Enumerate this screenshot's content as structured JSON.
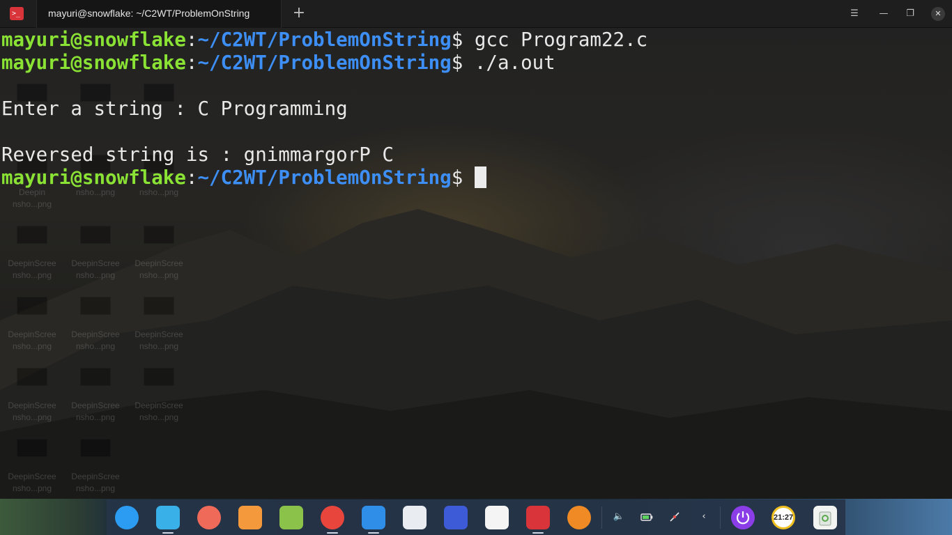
{
  "window": {
    "app_icon_glyph": ">_",
    "tab_title": "mayuri@snowflake: ~/C2WT/ProblemOnString",
    "new_tab_glyph": "+",
    "menu_glyph": "☰",
    "minimize_glyph": "—",
    "maximize_glyph": "❐",
    "close_glyph": "✕"
  },
  "terminal": {
    "lines": [
      {
        "user": "mayuri@snowflake",
        "sep": ":",
        "path": "~/C2WT/ProblemOnString",
        "prompt": "$",
        "cmd": " gcc Program22.c"
      },
      {
        "user": "mayuri@snowflake",
        "sep": ":",
        "path": "~/C2WT/ProblemOnString",
        "prompt": "$",
        "cmd": " ./a.out"
      },
      {
        "text": ""
      },
      {
        "text": "Enter a string : C Programming"
      },
      {
        "text": ""
      },
      {
        "text": "Reversed string is : gnimmargorP C"
      },
      {
        "user": "mayuri@snowflake",
        "sep": ":",
        "path": "~/C2WT/ProblemOnString",
        "prompt": "$",
        "cmd": " "
      }
    ]
  },
  "desktop": {
    "icons": [
      {
        "line1": "",
        "line2": ""
      },
      {
        "line1": "",
        "line2": ""
      },
      {
        "line1": "",
        "line2": ""
      },
      {
        "line1": "Deepin",
        "line2": "nsho...png"
      },
      {
        "line1": "",
        "line2": "nsho...png"
      },
      {
        "line1": "",
        "line2": "nsho...png"
      },
      {
        "line1": "DeepinScree",
        "line2": "nsho...png"
      },
      {
        "line1": "DeepinScree",
        "line2": "nsho...png"
      },
      {
        "line1": "DeepinScree",
        "line2": "nsho...png"
      },
      {
        "line1": "DeepinScree",
        "line2": "nsho...png"
      },
      {
        "line1": "DeepinScree",
        "line2": "nsho...png"
      },
      {
        "line1": "DeepinScree",
        "line2": "nsho...png"
      },
      {
        "line1": "DeepinScree",
        "line2": "nsho...png"
      },
      {
        "line1": "DeepinScree",
        "line2": "nsho...png"
      },
      {
        "line1": "DeepinScree",
        "line2": "nsho...png"
      },
      {
        "line1": "DeepinScree",
        "line2": "nsho...png"
      },
      {
        "line1": "DeepinScree",
        "line2": "nsho...png"
      }
    ]
  },
  "dock": {
    "apps": [
      {
        "name": "launcher-icon",
        "color": "#2b9cf2"
      },
      {
        "name": "file-manager-icon",
        "color": "#3ab0e8"
      },
      {
        "name": "screen-recorder-icon",
        "color": "#f06a5a"
      },
      {
        "name": "app-store-icon",
        "color": "#f59a3c"
      },
      {
        "name": "music-icon",
        "color": "#8bc34a"
      },
      {
        "name": "chrome-icon",
        "color": "#e8453c"
      },
      {
        "name": "video-player-icon",
        "color": "#2f8ee8"
      },
      {
        "name": "settings-icon",
        "color": "#e9edf2"
      },
      {
        "name": "wps-writer-icon",
        "color": "#3d5bd6"
      },
      {
        "name": "text-editor-icon",
        "color": "#f4f4f4"
      },
      {
        "name": "terminal-icon",
        "color": "#d8343a"
      },
      {
        "name": "vlc-icon",
        "color": "#f08a24"
      }
    ],
    "tray": {
      "volume_glyph": "🔈",
      "back_glyph": "‹",
      "clock_text": "21:27"
    }
  }
}
